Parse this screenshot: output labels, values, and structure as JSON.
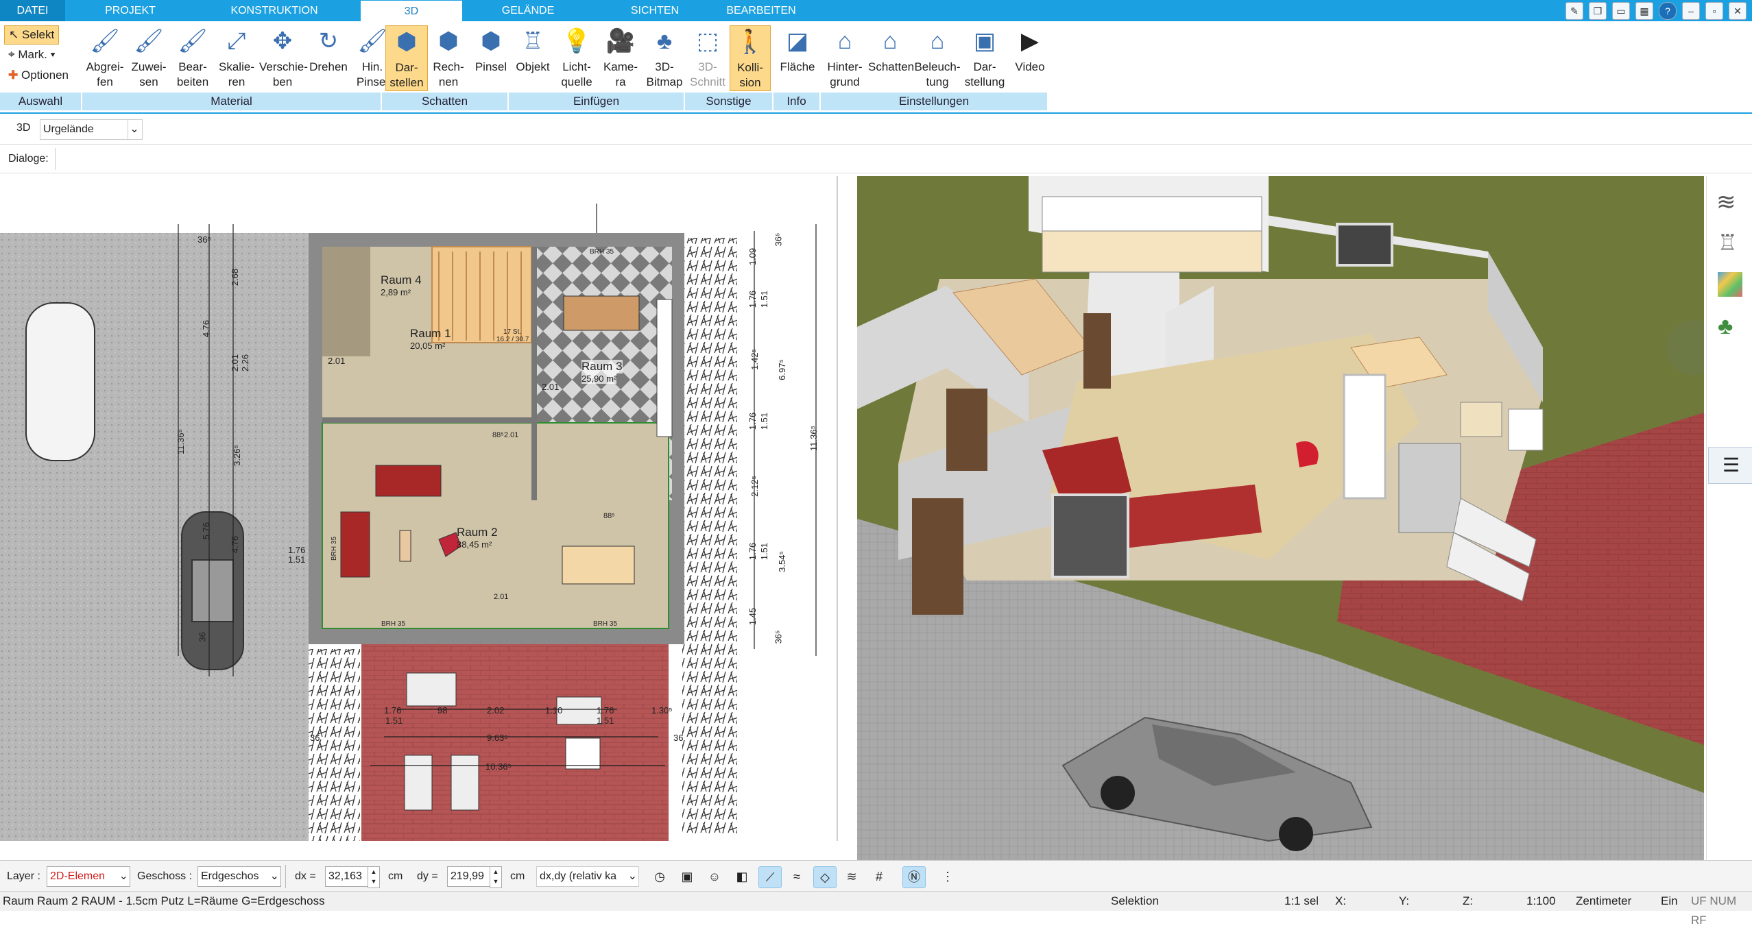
{
  "menu": {
    "tabs": [
      "DATEI",
      "PROJEKT",
      "KONSTRUKTION",
      "3D",
      "GELÄNDE",
      "SICHTEN",
      "BEARBEITEN"
    ],
    "active": "3D"
  },
  "ribbon": {
    "auswahl": {
      "selekt": "Selekt",
      "mark": "Mark.",
      "optionen": "Optionen",
      "group": "Auswahl"
    },
    "material": {
      "buttons": [
        "Abgrei-\nfen",
        "Zuwei-\nsen",
        "Bear-\nbeiten",
        "Skalie-\nren",
        "Verschie-\nben",
        "Drehen",
        "Hin.\nPinsel"
      ],
      "group": "Material"
    },
    "schatten": {
      "buttons": [
        "Dar-\nstellen",
        "Rech-\nnen",
        "Pinsel"
      ],
      "group": "Schatten"
    },
    "einfuegen": {
      "buttons": [
        "Objekt",
        "Licht-\nquelle",
        "Kame-\nra",
        "3D-\nBitmap"
      ],
      "group": "Einfügen"
    },
    "sonstige": {
      "buttons": [
        "3D-\nSchnitt",
        "Kolli-\nsion"
      ],
      "group": "Sonstige"
    },
    "info": {
      "buttons": [
        "Fläche"
      ],
      "group": "Info"
    },
    "einstellungen": {
      "buttons": [
        "Hinter-\ngrund",
        "Schatten",
        "Beleuch-\ntung",
        "Dar-\nstellung",
        "Video"
      ],
      "group": "Einstellungen"
    }
  },
  "optbar": {
    "mode": "3D",
    "terrain": "Urgelände"
  },
  "dialogs_label": "Dialoge:",
  "plan": {
    "rooms": [
      {
        "name": "Raum 4",
        "area": "2,89 m²"
      },
      {
        "name": "Raum 1",
        "area": "20,05 m²"
      },
      {
        "name": "Raum 3",
        "area": "25,90 m²"
      },
      {
        "name": "Raum 2",
        "area": "38,45 m²"
      }
    ],
    "dims_vertical_left": [
      "36⁵",
      "2.68",
      "4.76",
      "2.01",
      "2.26",
      "11.36⁵",
      "3.26⁵",
      "5.76",
      "4.76",
      "36"
    ],
    "dims_vertical_right": [
      "36⁵",
      "1.09",
      "1.76",
      "1.51",
      "1.42⁵",
      "6.97⁵",
      "1.76",
      "1.51",
      "2.12⁵",
      "11.36⁵",
      "1.76",
      "1.51",
      "3.54⁵",
      "1.45",
      "36⁵"
    ],
    "dims_terrace": [
      "1.76",
      "1.51",
      "2.02",
      "1.10",
      "1.76",
      "1.51",
      "98",
      "1.30⁵",
      "9.63⁵",
      "10.36⁵",
      "36",
      "36"
    ],
    "misc": [
      "BRH 35",
      "BRH 35",
      "BRH 35",
      "BRH 35",
      "1.76",
      "1.51",
      "2.01",
      "2.01",
      "88⁵",
      "2.01",
      "88⁵",
      "2.01",
      "17 St.",
      "16.2 / 30.7"
    ]
  },
  "toolbar": {
    "layer_label": "Layer :",
    "layer_value": "2D-Elemen",
    "geschoss_label": "Geschoss :",
    "geschoss_value": "Erdgeschos",
    "dx_label": "dx =",
    "dx_value": "32,163",
    "dx_unit": "cm",
    "dy_label": "dy =",
    "dy_value": "219,99",
    "dy_unit": "cm",
    "mode_value": "dx,dy (relativ ka"
  },
  "status": {
    "text": "Raum Raum 2 RAUM - 1.5cm Putz L=Räume G=Erdgeschoss",
    "selektion": "Selektion",
    "sel": "1:1 sel",
    "x": "X:",
    "y": "Y:",
    "z": "Z:",
    "scale": "1:100",
    "unit": "Zentimeter",
    "ein": "Ein",
    "flags": "UF NUM RF"
  },
  "colors": {
    "accent": "#1ba1e2",
    "ribbon_group": "#bfe3f7",
    "selected_button": "#fdd98b",
    "terrace": "#b55555",
    "lawn": "#6f7a3a",
    "paving": "#a8a8a8",
    "plan_floor": "#cfc4a8",
    "red_sofa": "#a82828"
  }
}
